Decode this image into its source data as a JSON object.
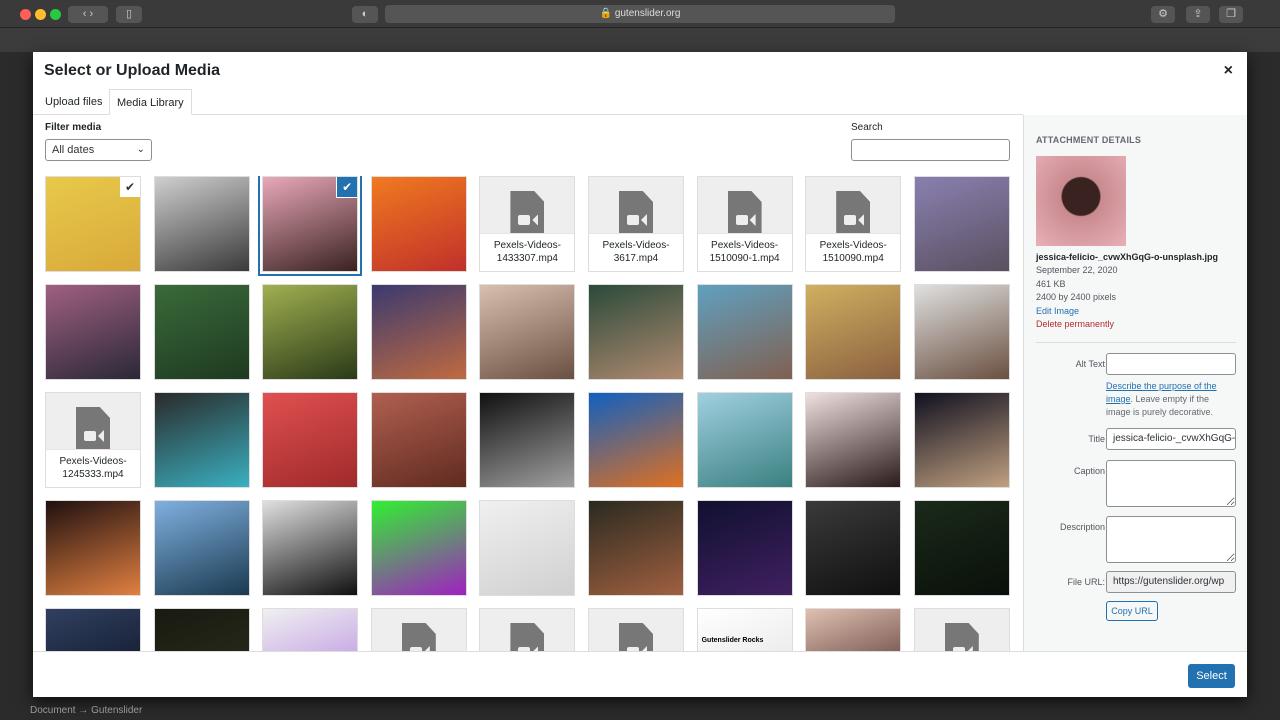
{
  "browser": {
    "url": "gutenslider.org"
  },
  "modal": {
    "title": "Select or Upload Media",
    "close": "×",
    "tabs": [
      {
        "label": "Upload files"
      },
      {
        "label": "Media Library"
      }
    ],
    "filter_label": "Filter media",
    "filter_value": "All dates",
    "search_label": "Search",
    "search_value": ""
  },
  "items": [
    {
      "type": "image",
      "colors": [
        "#e8c94a",
        "#d9a93a"
      ],
      "checked": true
    },
    {
      "type": "image",
      "colors": [
        "#cfcfcf",
        "#3a3a3a"
      ]
    },
    {
      "type": "image",
      "colors": [
        "#e8a8b8",
        "#3a2220"
      ],
      "selected": true
    },
    {
      "type": "image",
      "colors": [
        "#f07a20",
        "#c0302a"
      ]
    },
    {
      "type": "video",
      "name": "Pexels-Videos-1433307.mp4"
    },
    {
      "type": "video",
      "name": "Pexels-Videos-3617.mp4"
    },
    {
      "type": "video",
      "name": "Pexels-Videos-1510090-1.mp4"
    },
    {
      "type": "video",
      "name": "Pexels-Videos-1510090.mp4"
    },
    {
      "type": "image",
      "colors": [
        "#8a80b0",
        "#5a5060"
      ]
    },
    {
      "type": "image",
      "colors": [
        "#a06080",
        "#2a2838"
      ]
    },
    {
      "type": "image",
      "colors": [
        "#3a6a3a",
        "#1e3a20"
      ]
    },
    {
      "type": "image",
      "colors": [
        "#a0b050",
        "#2a3a18"
      ]
    },
    {
      "type": "image",
      "colors": [
        "#3a3a70",
        "#c06a40"
      ]
    },
    {
      "type": "image",
      "colors": [
        "#d8c0b0",
        "#6a5040"
      ]
    },
    {
      "type": "image",
      "colors": [
        "#2a4a3a",
        "#b08a70"
      ]
    },
    {
      "type": "image",
      "colors": [
        "#60a0c0",
        "#806050"
      ]
    },
    {
      "type": "image",
      "colors": [
        "#d0b060",
        "#8a6040"
      ]
    },
    {
      "type": "image",
      "colors": [
        "#e0e0e0",
        "#6a5040"
      ]
    },
    {
      "type": "video",
      "name": "Pexels-Videos-1245333.mp4"
    },
    {
      "type": "image",
      "colors": [
        "#2a2a2a",
        "#3ab0c0"
      ]
    },
    {
      "type": "image",
      "colors": [
        "#e05050",
        "#a02a2a"
      ]
    },
    {
      "type": "image",
      "colors": [
        "#b06050",
        "#602a20"
      ]
    },
    {
      "type": "image",
      "colors": [
        "#101010",
        "#a0a0a0"
      ]
    },
    {
      "type": "image",
      "colors": [
        "#1060c0",
        "#e07020"
      ]
    },
    {
      "type": "image",
      "colors": [
        "#a0d0e0",
        "#3a8080"
      ]
    },
    {
      "type": "image",
      "colors": [
        "#f0e0e0",
        "#2a1a1a"
      ]
    },
    {
      "type": "image",
      "colors": [
        "#101020",
        "#c0a080"
      ]
    },
    {
      "type": "image",
      "colors": [
        "#201010",
        "#e08040"
      ]
    },
    {
      "type": "image",
      "colors": [
        "#80b0e0",
        "#1a3a50"
      ]
    },
    {
      "type": "image",
      "colors": [
        "#e0e0e0",
        "#101010"
      ]
    },
    {
      "type": "image",
      "colors": [
        "#30f030",
        "#a020c0"
      ]
    },
    {
      "type": "image",
      "colors": [
        "#f0f0f0",
        "#d0d0d0"
      ]
    },
    {
      "type": "image",
      "colors": [
        "#2a2a20",
        "#a06040"
      ]
    },
    {
      "type": "image",
      "colors": [
        "#101030",
        "#402060"
      ]
    },
    {
      "type": "image",
      "colors": [
        "#3a3a3a",
        "#101010"
      ]
    },
    {
      "type": "image",
      "colors": [
        "#1a2a1a",
        "#0a100a"
      ]
    },
    {
      "type": "image",
      "colors": [
        "#304060",
        "#0a1020"
      ]
    },
    {
      "type": "image",
      "colors": [
        "#1a1a10",
        "#2a3020"
      ]
    },
    {
      "type": "image",
      "colors": [
        "#f0f0f0",
        "#b080e0"
      ]
    },
    {
      "type": "video",
      "name": ""
    },
    {
      "type": "video",
      "name": ""
    },
    {
      "type": "video",
      "name": ""
    },
    {
      "type": "image",
      "colors": [
        "#ffffff",
        "#e0e0e0"
      ],
      "caption": "Gutenslider Rocks"
    },
    {
      "type": "image",
      "colors": [
        "#e0c0b0",
        "#402020"
      ]
    },
    {
      "type": "video",
      "name": ""
    }
  ],
  "details": {
    "heading": "ATTACHMENT DETAILS",
    "filename": "jessica-felicio-_cvwXhGqG-o-unsplash.jpg",
    "date": "September 22, 2020",
    "size": "461 KB",
    "dimensions": "2400 by 2400 pixels",
    "edit": "Edit Image",
    "delete": "Delete permanently",
    "alt_label": "Alt Text",
    "alt_value": "",
    "help_link": "Describe the purpose of the image",
    "help_text": ". Leave empty if the image is purely decorative.",
    "title_label": "Title",
    "title_value": "jessica-felicio-_cvwXhGqG-o-unsplash",
    "caption_label": "Caption",
    "description_label": "Description",
    "url_label": "File URL:",
    "url_value": "https://gutenslider.org/wp",
    "copy": "Copy URL"
  },
  "footer": {
    "select": "Select"
  },
  "breadcrumb": "Document → Gutenslider",
  "accent": "#2271b1"
}
